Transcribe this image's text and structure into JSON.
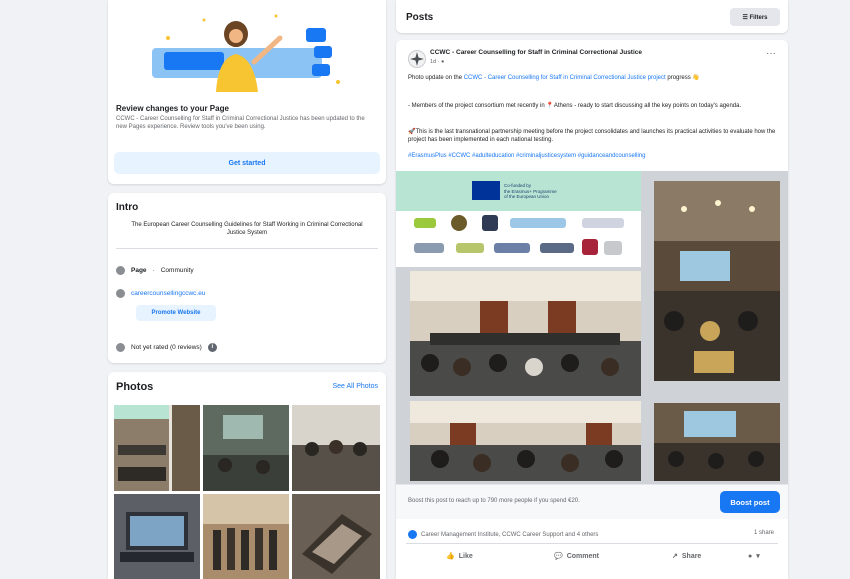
{
  "review_card": {
    "title": "Review changes to your Page",
    "description": "CCWC - Career Counselling for Staff in Criminal Correctional Justice has been updated to the new Pages experience. Review tools you've been using.",
    "button_label": "Get started"
  },
  "intro": {
    "title": "Intro",
    "bio": "The European Career Counselling Guidelines for Staff Working in Criminal Correctional Justice System",
    "page_label": "Page",
    "page_category": "Community",
    "website": "careercounsellingccwc.eu",
    "promote_button": "Promote Website",
    "not_yet_rated": "Not yet rated (0 reviews)"
  },
  "photos": {
    "title": "Photos",
    "see_all": "See All Photos"
  },
  "posts_header": {
    "title": "Posts",
    "filters_label": "Filters"
  },
  "post": {
    "author": "CCWC - Career Counselling for Staff in Criminal Correctional Justice",
    "time": "1d",
    "line1_start": "Photo update on the ",
    "line1_highlight": "CCWC - Career Counselling for Staff in Criminal Correctional Justice project",
    "line1_end": " progress",
    "line2_start": "- Members of the project consortium met recently in ",
    "line2_place": "Athens",
    "line2_end": " - ready to start discussing all the key points on today's agenda.",
    "line3": "This is the last transnational partnership meeting before the project consolidates and launches its practical activities to evaluate how the project has been implemented in each national testing.",
    "hashtags": "#ErasmusPlus #CCWC #adulteducation #criminaljusticesystem #guidanceandcounselling",
    "eu_text_line1": "Co-funded by",
    "eu_text_line2": "the Erasmus+ Programme",
    "eu_text_line3": "of the European Union",
    "ad_text": "Boost this post to reach up to 790 more people if you spend €20.",
    "boost_button": "Boost post",
    "reactions_text": "Career Management Institute, CCWC Career Support and 4 others",
    "shares_text": "1 share",
    "like_label": "Like",
    "comment_label": "Comment",
    "share_label": "Share"
  },
  "colors": {
    "accent": "#1877f2",
    "background": "#f0f2f5",
    "card": "#ffffff",
    "banner_green": "#b8e4d4"
  }
}
